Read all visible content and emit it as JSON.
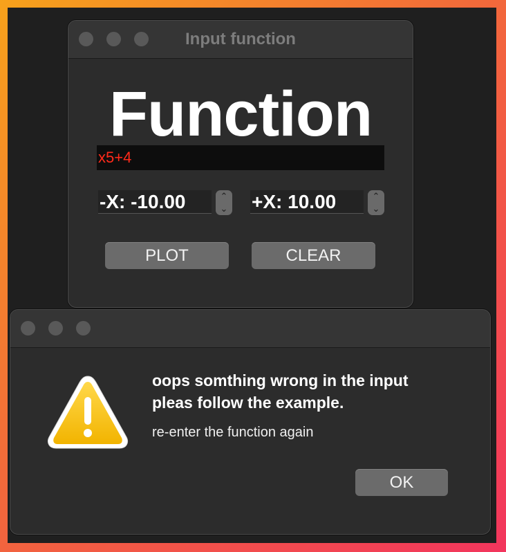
{
  "input_window": {
    "title": "Input function",
    "heading": "Function",
    "function_input": {
      "value": "x5+4",
      "text_color": "#ff2a1a"
    },
    "min_x": {
      "label": "-X:",
      "value": "-10.00"
    },
    "max_x": {
      "label": "+X:",
      "value": "10.00"
    },
    "plot_label": "PLOT",
    "clear_label": "CLEAR"
  },
  "alert_dialog": {
    "title_line1": "oops somthing wrong in the input",
    "title_line2": "pleas follow the example.",
    "body": "re-enter the function again",
    "ok_label": "OK",
    "icon": "warning-icon"
  }
}
